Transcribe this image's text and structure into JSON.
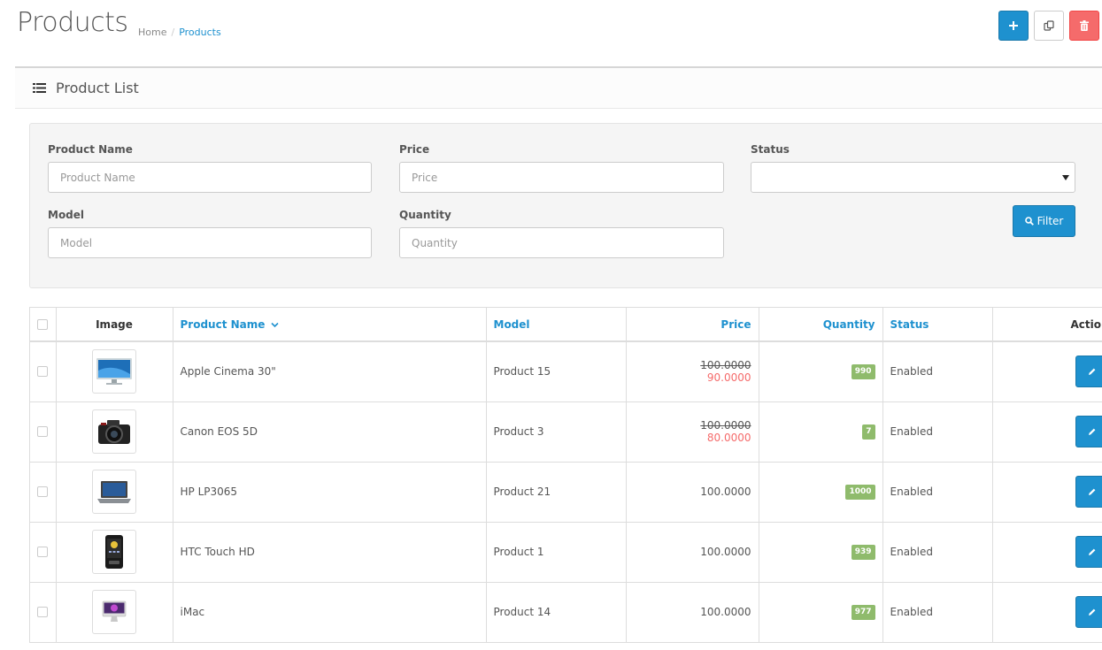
{
  "header": {
    "title": "Products",
    "breadcrumb": {
      "home": "Home",
      "separator": "/",
      "current": "Products"
    }
  },
  "toolbar": {
    "add": "add-icon",
    "copy": "copy-icon",
    "delete": "trash-icon"
  },
  "panel": {
    "title": "Product List"
  },
  "filter": {
    "product_name": {
      "label": "Product Name",
      "placeholder": "Product Name",
      "value": ""
    },
    "price": {
      "label": "Price",
      "placeholder": "Price",
      "value": ""
    },
    "status": {
      "label": "Status",
      "selected": ""
    },
    "model": {
      "label": "Model",
      "placeholder": "Model",
      "value": ""
    },
    "quantity": {
      "label": "Quantity",
      "placeholder": "Quantity",
      "value": ""
    },
    "button_label": "Filter"
  },
  "table": {
    "columns": {
      "image": "Image",
      "name": "Product Name",
      "model": "Model",
      "price": "Price",
      "quantity": "Quantity",
      "status": "Status",
      "action": "Action"
    },
    "rows": [
      {
        "name": "Apple Cinema 30\"",
        "model": "Product 15",
        "price": "100.0000",
        "special": "90.0000",
        "quantity": "990",
        "status": "Enabled",
        "image": "monitor"
      },
      {
        "name": "Canon EOS 5D",
        "model": "Product 3",
        "price": "100.0000",
        "special": "80.0000",
        "quantity": "7",
        "status": "Enabled",
        "image": "camera"
      },
      {
        "name": "HP LP3065",
        "model": "Product 21",
        "price": "100.0000",
        "special": "",
        "quantity": "1000",
        "status": "Enabled",
        "image": "laptop"
      },
      {
        "name": "HTC Touch HD",
        "model": "Product 1",
        "price": "100.0000",
        "special": "",
        "quantity": "939",
        "status": "Enabled",
        "image": "phone"
      },
      {
        "name": "iMac",
        "model": "Product 14",
        "price": "100.0000",
        "special": "",
        "quantity": "977",
        "status": "Enabled",
        "image": "imac"
      }
    ]
  },
  "colors": {
    "primary": "#1e91cf",
    "danger": "#f56b6b",
    "badge": "#8fbb6c"
  }
}
